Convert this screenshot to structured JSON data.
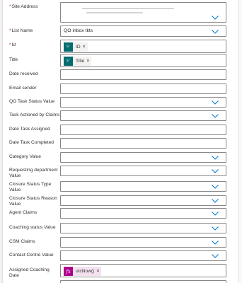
{
  "fields": {
    "site_address": {
      "label": "Site Address",
      "required_mark": "*"
    },
    "list_name": {
      "label": "List Name",
      "required_mark": "*",
      "value": "QO inbox tkts"
    },
    "id": {
      "label": "Id",
      "required_mark": "*",
      "token": {
        "text": "ID",
        "icon": "sharepoint-icon",
        "color": "#036c70"
      }
    },
    "title": {
      "label": "Title",
      "token": {
        "text": "Title",
        "icon": "sharepoint-icon",
        "color": "#036c70"
      }
    },
    "date_received": {
      "label": "Date received"
    },
    "email_sender": {
      "label": "Email sender"
    },
    "qo_task_status": {
      "label": "QO Task Status Value"
    },
    "task_actioned_by": {
      "label": "Task Actioned by Claims"
    },
    "date_task_assigned": {
      "label": "Date Task Assigned"
    },
    "date_task_completed": {
      "label": "Date Task Completed"
    },
    "category": {
      "label": "Category Value"
    },
    "requesting_department": {
      "label": "Requesting department Value"
    },
    "closure_status_type": {
      "label": "Closure Status Type Value"
    },
    "closure_status_reason": {
      "label": "Closure Status Reason Value"
    },
    "agent_claims": {
      "label": "Agent Claims"
    },
    "coaching_status": {
      "label": "Coaching status Value"
    },
    "csm_claims": {
      "label": "CSM Claims"
    },
    "contact_centre": {
      "label": "Contact Centre Value"
    },
    "assigned_coaching_date": {
      "label": "Assigned Coaching Date",
      "token": {
        "text": "utcNow()",
        "icon": "fx",
        "color": "#ad008c",
        "bg": "#f4e1f0"
      }
    }
  },
  "colors": {
    "required": "#a4262c",
    "chevron": "#0078d4",
    "border": "#8a8886"
  }
}
